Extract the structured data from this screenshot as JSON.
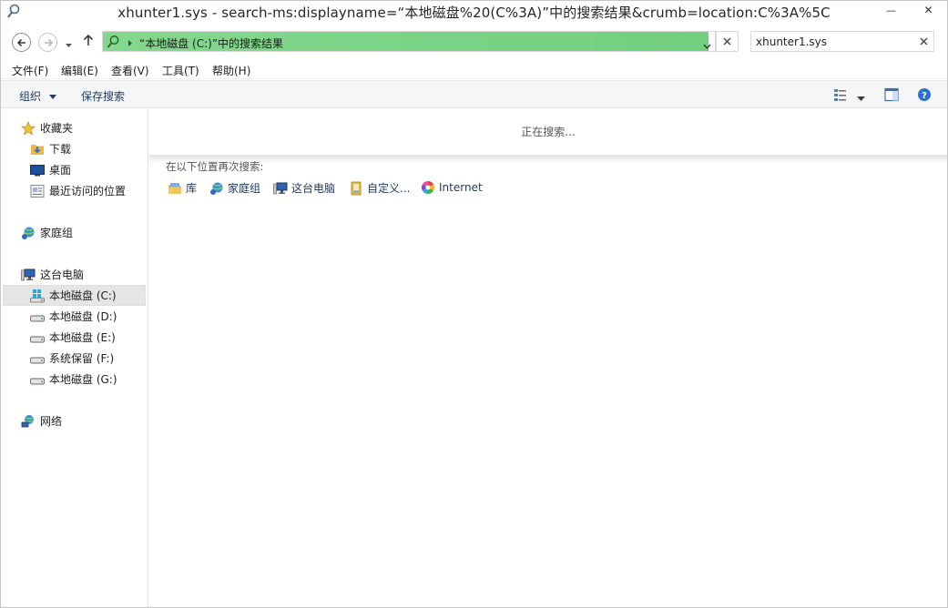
{
  "window": {
    "title": "xhunter1.sys - search-ms:displayname=“本地磁盘%20(C%3A)”中的搜索结果&crumb=location:C%3A%5C",
    "minimize_symbol": "—",
    "close_symbol": "✕"
  },
  "address": {
    "path_text": "“本地磁盘 (C:)”中的搜索结果",
    "progress": 0.99
  },
  "search": {
    "value": "xhunter1.sys"
  },
  "menu": {
    "items": [
      {
        "label": "文件(F)"
      },
      {
        "label": "编辑(E)"
      },
      {
        "label": "查看(V)"
      },
      {
        "label": "工具(T)"
      },
      {
        "label": "帮助(H)"
      }
    ]
  },
  "commands": {
    "organize": "组织",
    "save_search": "保存搜索"
  },
  "nav": {
    "favorites": "收藏夹",
    "downloads": "下载",
    "desktop": "桌面",
    "recent": "最近访问的位置",
    "homegroup": "家庭组",
    "this_pc": "这台电脑",
    "drive_c": "本地磁盘 (C:)",
    "drive_d": "本地磁盘 (D:)",
    "drive_e": "本地磁盘 (E:)",
    "drive_f": "系统保留 (F:)",
    "drive_g": "本地磁盘 (G:)",
    "network": "网络"
  },
  "content": {
    "status": "正在搜索...",
    "search_again_label": "在以下位置再次搜索:",
    "locations": [
      {
        "label": "库"
      },
      {
        "label": "家庭组"
      },
      {
        "label": "这台电脑"
      },
      {
        "label": "自定义..."
      },
      {
        "label": "Internet"
      }
    ]
  },
  "colors": {
    "progress_green": "#76d282",
    "link_blue": "#1e3b66",
    "selected_bg": "#e5e5e5"
  }
}
